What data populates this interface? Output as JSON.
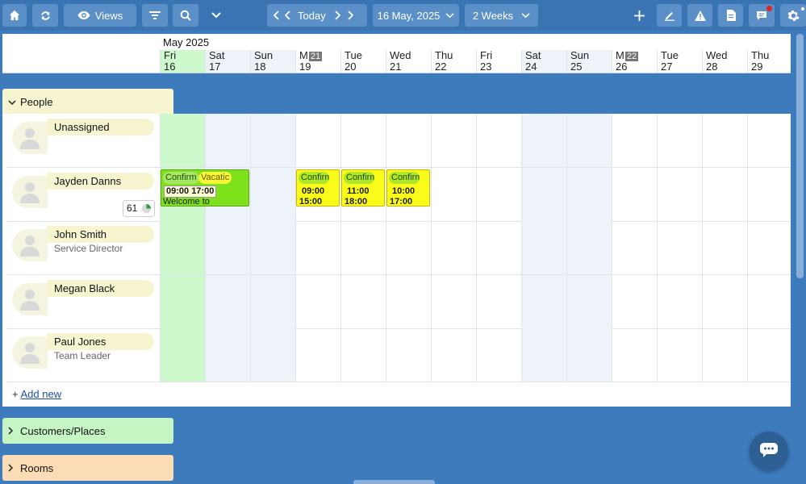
{
  "toolbar": {
    "views_label": "Views",
    "today_label": "Today",
    "date_label": "16 May, 2025",
    "range_label": "2 Weeks"
  },
  "calendar": {
    "month": "May 2025",
    "days": [
      {
        "dow": "Fri",
        "date": "16",
        "kind": "today"
      },
      {
        "dow": "Sat",
        "date": "17",
        "kind": "weekend"
      },
      {
        "dow": "Sun",
        "date": "18",
        "kind": "weekend"
      },
      {
        "dow": "M",
        "date": "19",
        "week": "21",
        "kind": "weekday"
      },
      {
        "dow": "Tue",
        "date": "20",
        "kind": "weekday"
      },
      {
        "dow": "Wed",
        "date": "21",
        "kind": "weekday"
      },
      {
        "dow": "Thu",
        "date": "22",
        "kind": "weekday"
      },
      {
        "dow": "Fri",
        "date": "23",
        "kind": "weekday"
      },
      {
        "dow": "Sat",
        "date": "24",
        "kind": "weekend"
      },
      {
        "dow": "Sun",
        "date": "25",
        "kind": "weekend"
      },
      {
        "dow": "M",
        "date": "26",
        "week": "22",
        "kind": "weekday"
      },
      {
        "dow": "Tue",
        "date": "27",
        "kind": "weekday"
      },
      {
        "dow": "Wed",
        "date": "28",
        "kind": "weekday"
      },
      {
        "dow": "Thu",
        "date": "29",
        "kind": "weekday"
      }
    ]
  },
  "sections": {
    "people": "People",
    "customers": "Customers/Places",
    "rooms": "Rooms"
  },
  "people": [
    {
      "name": "Unassigned",
      "role": ""
    },
    {
      "name": "Jayden Danns",
      "role": "",
      "count": "61"
    },
    {
      "name": "John Smith",
      "role": "Service Director"
    },
    {
      "name": "Megan Black",
      "role": ""
    },
    {
      "name": "Paul Jones",
      "role": "Team Leader"
    }
  ],
  "events": [
    {
      "status": "Confirm",
      "tag": "Vacatic",
      "time": "09:00 17:00",
      "sub": "Welcome to",
      "color": "#7fe01c"
    },
    {
      "status": "Confirm",
      "time": "09:00",
      "sub": "15:00",
      "color": "#fbfb1a"
    },
    {
      "status": "Confirm",
      "time": "11:00",
      "sub": "18:00",
      "color": "#fbfb1a"
    },
    {
      "status": "Confirm",
      "time": "10:00",
      "sub": "17:00",
      "color": "#fbfb1a"
    }
  ],
  "add_new": {
    "prefix": "+",
    "label": "Add new"
  },
  "icons": [
    "home-icon",
    "refresh-icon",
    "eye-icon",
    "filter-icon",
    "search-icon",
    "chevron-down-icon",
    "chevron-left-icon",
    "chevron-right-icon",
    "plus-icon",
    "pen-icon",
    "warning-icon",
    "document-icon",
    "chat-icon",
    "gear-icon",
    "person-icon"
  ],
  "colors": {
    "toolbar": "#3a74b3",
    "today": "#cdf9cc",
    "weekend": "#eef3fa",
    "people_tab": "#f6f5d0",
    "customers_tab": "#c6f5c4",
    "rooms_tab": "#fcdcb4",
    "notification": "#e52222"
  }
}
